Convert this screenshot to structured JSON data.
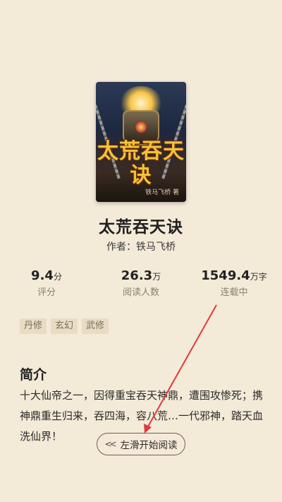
{
  "book": {
    "cover_title": "太荒吞天诀",
    "cover_author": "铁马飞桥 著",
    "title": "太荒吞天诀",
    "author_line": "作者：铁马飞桥"
  },
  "stats": [
    {
      "value": "9.4",
      "unit": "分",
      "label": "评分"
    },
    {
      "value": "26.3",
      "unit": "万",
      "label": "阅读人数"
    },
    {
      "value": "1549.4",
      "unit": "万字",
      "label": "连载中"
    }
  ],
  "tags": [
    "丹修",
    "玄幻",
    "武修"
  ],
  "intro": {
    "heading": "简介",
    "text": "十大仙帝之一，因得重宝吞天神鼎，遭围攻惨死；携神鼎重生归来，吞四海，容八荒…一代邪神，踏天血洗仙界！"
  },
  "read_button": {
    "icon": "double-chevron-left-icon",
    "label": "左滑开始阅读"
  },
  "colors": {
    "background": "#f4ead8",
    "tag_bg": "#e8dcc2",
    "annotation_arrow": "#e03a3a"
  }
}
